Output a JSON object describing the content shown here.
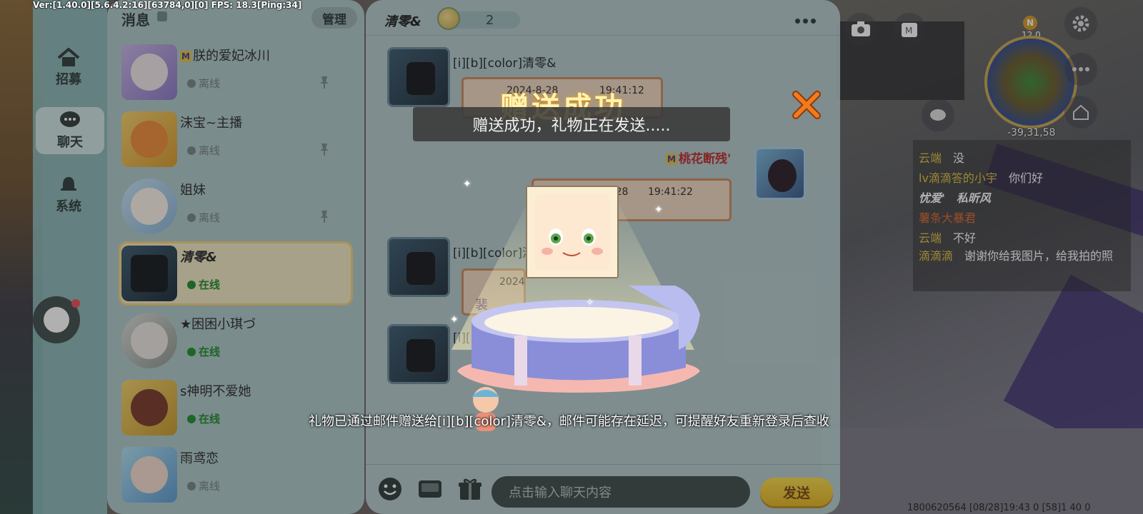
{
  "debug_text": "Ver:[1.40.0][5.6.4.2:16][63784,0][0] FPS: 18.3[Ping:34]",
  "left_nav": {
    "items": [
      {
        "label": "招募",
        "icon": "home-icon"
      },
      {
        "label": "聊天",
        "icon": "chat-bubble-icon"
      },
      {
        "label": "系统",
        "icon": "bell-icon"
      }
    ]
  },
  "contacts_panel": {
    "title": "消息",
    "manage_label": "管理",
    "contacts": [
      {
        "name": "朕的爱妃冰川",
        "status": "离线",
        "online": false,
        "pinned": true,
        "badge": true
      },
      {
        "name": "沫宝~主播",
        "status": "离线",
        "online": false,
        "pinned": true,
        "badge": false
      },
      {
        "name": "姐妹",
        "status": "离线",
        "online": false,
        "pinned": true,
        "badge": false
      },
      {
        "name": "清零&",
        "status": "在线",
        "online": true,
        "pinned": false,
        "badge": false,
        "selected": true
      },
      {
        "name": "★困困小琪づ",
        "status": "在线",
        "online": true,
        "pinned": false,
        "badge": false
      },
      {
        "name": "s神明不爱她",
        "status": "在线",
        "online": true,
        "pinned": false,
        "badge": false
      },
      {
        "name": "雨鸢恋",
        "status": "离线",
        "online": false,
        "pinned": false,
        "badge": false
      }
    ]
  },
  "chat": {
    "title": "清零&",
    "gift_count": "2",
    "messages": [
      {
        "sender": "[i][b][color]清零&",
        "date": "2024-8-28",
        "time": "19:41:12"
      },
      {
        "sender": "桃花断残'",
        "date": "2024-8-28",
        "time": "19:41:22"
      },
      {
        "sender": "[i][b][color]清",
        "date": "2024",
        "extra": "裴"
      },
      {
        "sender": "[i][b"
      }
    ],
    "input_placeholder": "点击输入聊天内容",
    "send_label": "发送"
  },
  "gift_popup": {
    "title": "赠送成功",
    "toast": "赠送成功，礼物正在发送.....",
    "note": "礼物已通过邮件赠送给[i][b][color]清零&，邮件可能存在延迟，可提醒好友重新登录后查收"
  },
  "game_hud": {
    "compass": "N",
    "angle": "12.0",
    "coords": "-39,31,58",
    "chat_lines": [
      {
        "name": "云端",
        "text": "没"
      },
      {
        "name": "lv滴滴答的小宇",
        "text": "你们好"
      },
      {
        "name": "忧爱'",
        "text": "私昕风"
      },
      {
        "name": "薯条大暴君",
        "text": ""
      },
      {
        "name": "云端",
        "text": "不好"
      },
      {
        "name": "滴滴滴",
        "text": "谢谢你给我图片，给我拍的照"
      }
    ],
    "bottom_info": "1800620564   [08/28]19:43 0   [58]1 40 0"
  },
  "colors": {
    "online": "#1e8e2c",
    "offline": "#758586",
    "send_button": "#f2c936",
    "selected_border": "#f2d07a",
    "close_x": "#f47a1a"
  }
}
